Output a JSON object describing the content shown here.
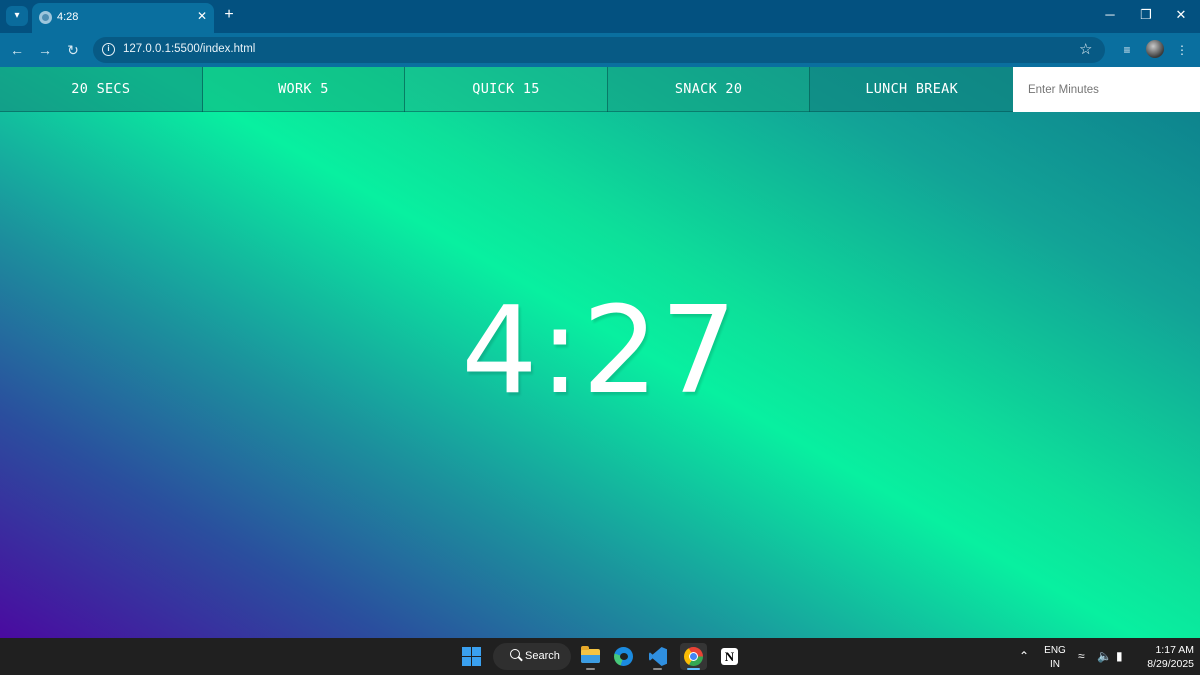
{
  "browser": {
    "tab": {
      "title": "4:28",
      "close_glyph": "✕"
    },
    "new_tab_glyph": "+",
    "address": {
      "url": "127.0.0.1:5500/index.html"
    },
    "window_controls": {
      "minimize": "─",
      "restore": "❐",
      "close": "✕"
    },
    "icons": {
      "tab_menu": "chevron-down-icon",
      "back": "arrow-left-icon",
      "forward": "arrow-right-icon",
      "reload": "reload-icon",
      "site_info": "info-icon",
      "bookmark": "star-icon",
      "media": "media-control-icon",
      "menu": "more-vertical-icon"
    }
  },
  "page": {
    "timer_buttons": [
      {
        "label": "20 SECS"
      },
      {
        "label": "WORK 5"
      },
      {
        "label": "QUICK 15"
      },
      {
        "label": "SNACK 20"
      },
      {
        "label": "LUNCH BREAK"
      }
    ],
    "custom_minutes": {
      "placeholder": "Enter Minutes",
      "value": ""
    },
    "display_time": "4:27",
    "colors": {
      "gradient": [
        "#4a0aa0",
        "#1c8f9d",
        "#08f0a0",
        "#0d7d8c"
      ],
      "text": "#ffffff"
    }
  },
  "taskbar": {
    "search_label": "Search",
    "apps": [
      "file-explorer-icon",
      "edge-icon",
      "vscode-icon",
      "chrome-icon",
      "notion-icon"
    ],
    "active_app": "chrome-icon",
    "tray": {
      "language": "ENG",
      "region": "IN",
      "time": "1:17 AM",
      "date": "8/29/2025"
    }
  }
}
